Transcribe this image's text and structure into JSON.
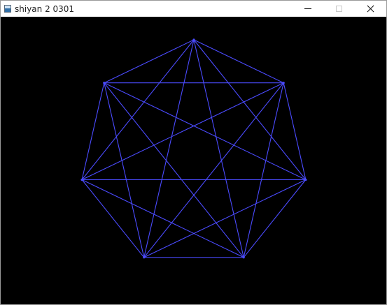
{
  "window": {
    "title": "shiyan 2 0301",
    "icon": "app-window-icon",
    "controls": {
      "minimize": "minimize-icon",
      "maximize": "maximize-icon",
      "maximize_enabled": false,
      "close": "close-icon"
    }
  },
  "canvas": {
    "background": "#000000",
    "figure": {
      "type": "complete-graph-heptagon",
      "vertex_count": 7,
      "line_color": "#4b4bff"
    }
  }
}
